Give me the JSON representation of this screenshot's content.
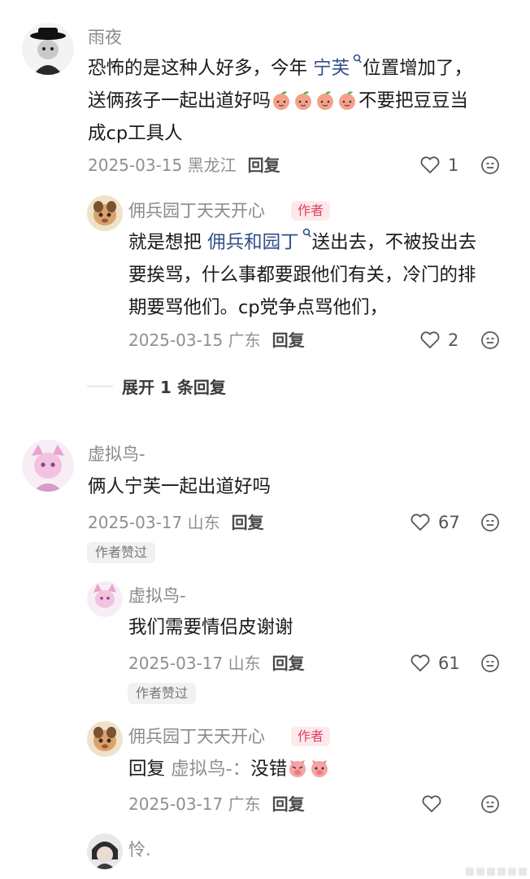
{
  "comments": [
    {
      "name": "雨夜",
      "text_line1_a": "恐怖的是这种人好多，今年 ",
      "text_line1_link": "宁芙",
      "text_line1_b": "位置增加了，",
      "text_line2": "送俩孩子一起出道好吗",
      "text_line2_b": "不要把豆豆当",
      "text_line3": "成cp工具人",
      "date": "2025-03-15 黑龙江",
      "reply": "回复",
      "likes": "1",
      "replies": [
        {
          "name": "佣兵园丁天天开心",
          "badge": "作者",
          "text_line1_a": "就是想把 ",
          "text_line1_link": "佣兵和园丁",
          "text_line1_b": "送出去，不被投出去",
          "text_line2": "要挨骂，什么事都要跟他们有关，冷门的排",
          "text_line3": "期要骂他们。cp党争点骂他们，",
          "date": "2025-03-15 广东",
          "reply": "回复",
          "likes": "2"
        }
      ],
      "expand": "展开 1 条回复"
    },
    {
      "name": "虚拟鸟-",
      "text": "俩人宁芙一起出道好吗",
      "date": "2025-03-17 山东",
      "reply": "回复",
      "likes": "67",
      "author_liked": "作者赞过",
      "replies": [
        {
          "name": "虚拟鸟-",
          "text": "我们需要情侣皮谢谢",
          "date": "2025-03-17 山东",
          "reply": "回复",
          "likes": "61",
          "author_liked": "作者赞过"
        },
        {
          "name": "佣兵园丁天天开心",
          "badge": "作者",
          "reply_prefix": "回复 ",
          "reply_to": "虚拟鸟-：",
          "text": "没错",
          "date": "2025-03-17 广东",
          "reply": "回复",
          "likes": ""
        }
      ]
    },
    {
      "name": "怜."
    }
  ],
  "icons": {
    "like": "heart-outline-icon",
    "emoji": "emoji-face-icon",
    "search_mark": "search-icon"
  },
  "colors": {
    "link": "#2f4f87",
    "author_badge": "#e0405a",
    "meta": "#8f8f8f"
  }
}
